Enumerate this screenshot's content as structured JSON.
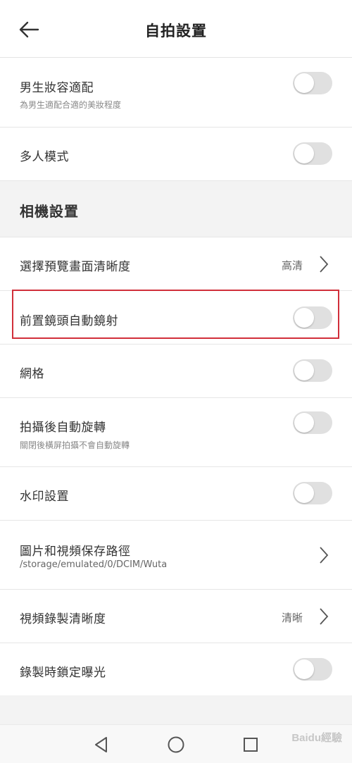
{
  "header": {
    "title": "自拍設置",
    "back_icon": "arrow-left-icon"
  },
  "settings_top": [
    {
      "label": "男生妝容適配",
      "sub": "為男生適配合適的美妝程度",
      "toggle": false
    },
    {
      "label": "多人模式",
      "toggle": false
    }
  ],
  "section": {
    "title": "相機設置"
  },
  "camera_settings": [
    {
      "label": "選擇預覽畫面清晰度",
      "value": "高清",
      "chevron": true
    },
    {
      "label": "前置鏡頭自動鏡射",
      "toggle": false,
      "highlighted": true
    },
    {
      "label": "網格",
      "toggle": false
    },
    {
      "label": "拍攝後自動旋轉",
      "sub": "關閉後橫屏拍攝不會自動旋轉",
      "toggle": false
    },
    {
      "label": "水印設置",
      "toggle": false
    },
    {
      "label": "圖片和視頻保存路徑",
      "sub": "/storage/emulated/0/DCIM/Wuta",
      "chevron": true
    },
    {
      "label": "視頻錄製清晰度",
      "value": "清晰",
      "chevron": true
    },
    {
      "label": "錄製時鎖定曝光",
      "toggle": false
    }
  ],
  "navbar": {
    "back": "triangle-back-icon",
    "home": "circle-home-icon",
    "recent": "square-recents-icon"
  },
  "watermark": "Baidu經驗",
  "colors": {
    "highlight": "#d12f3a",
    "toggle_off": "#e0e0e0",
    "section_bg": "#f3f3f3"
  }
}
